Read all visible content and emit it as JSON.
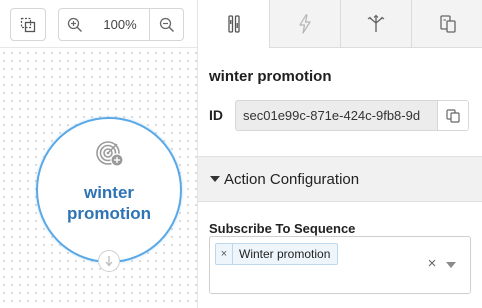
{
  "toolbar": {
    "zoom_level": "100%"
  },
  "node": {
    "title_line1": "winter",
    "title_line2": "promotion",
    "icon": "target-add-icon"
  },
  "panel": {
    "tabs": [
      {
        "icon": "settings-sliders-icon",
        "active": true
      },
      {
        "icon": "lightning-icon",
        "active": false
      },
      {
        "icon": "branch-icon",
        "active": false
      },
      {
        "icon": "copy-layout-icon",
        "active": false
      }
    ],
    "action_title": "winter promotion",
    "id_label": "ID",
    "id_value": "sec01e99c-871e-424c-9fb8-9d",
    "section_title": "Action Configuration",
    "field_label": "Subscribe To Sequence",
    "selected_tags": [
      {
        "remove": "×",
        "label": "Winter promotion"
      }
    ],
    "clear_symbol": "×"
  },
  "colors": {
    "accent": "#5aa8e6",
    "node_text": "#2e74b5"
  }
}
